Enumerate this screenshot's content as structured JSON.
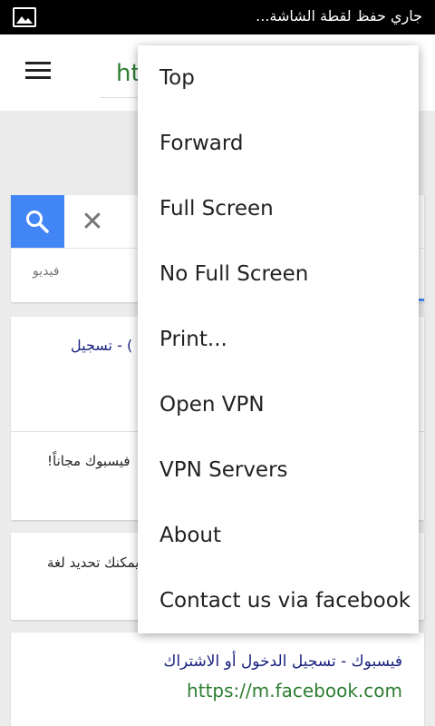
{
  "status_bar": {
    "notification_text": "جاري حفظ لقطة الشاشة...",
    "notification_icon": "image-icon"
  },
  "toolbar": {
    "url_partial": "ht",
    "menu_icon": "hamburger-menu-icon"
  },
  "search": {
    "clear_symbol": "✕",
    "tab_video": "فيديو"
  },
  "results": [
    {
      "title": ") - تسجيل",
      "snippet": "فيسبوك مجاناً!"
    },
    {
      "snippet": "يمكنك تحديد لغة"
    },
    {
      "title": "فيسبوك - تسجيل الدخول أو الاشتراك",
      "url": "https://m.facebook.com"
    }
  ],
  "menu": {
    "items": [
      "Top",
      "Forward",
      "Full Screen",
      "No Full Screen",
      "Print...",
      "Open VPN",
      "VPN Servers",
      "About",
      "Contact us via facebook"
    ]
  },
  "colors": {
    "accent_blue": "#4285f4",
    "url_green": "#2e7d32",
    "link_navy": "#1a237e"
  }
}
